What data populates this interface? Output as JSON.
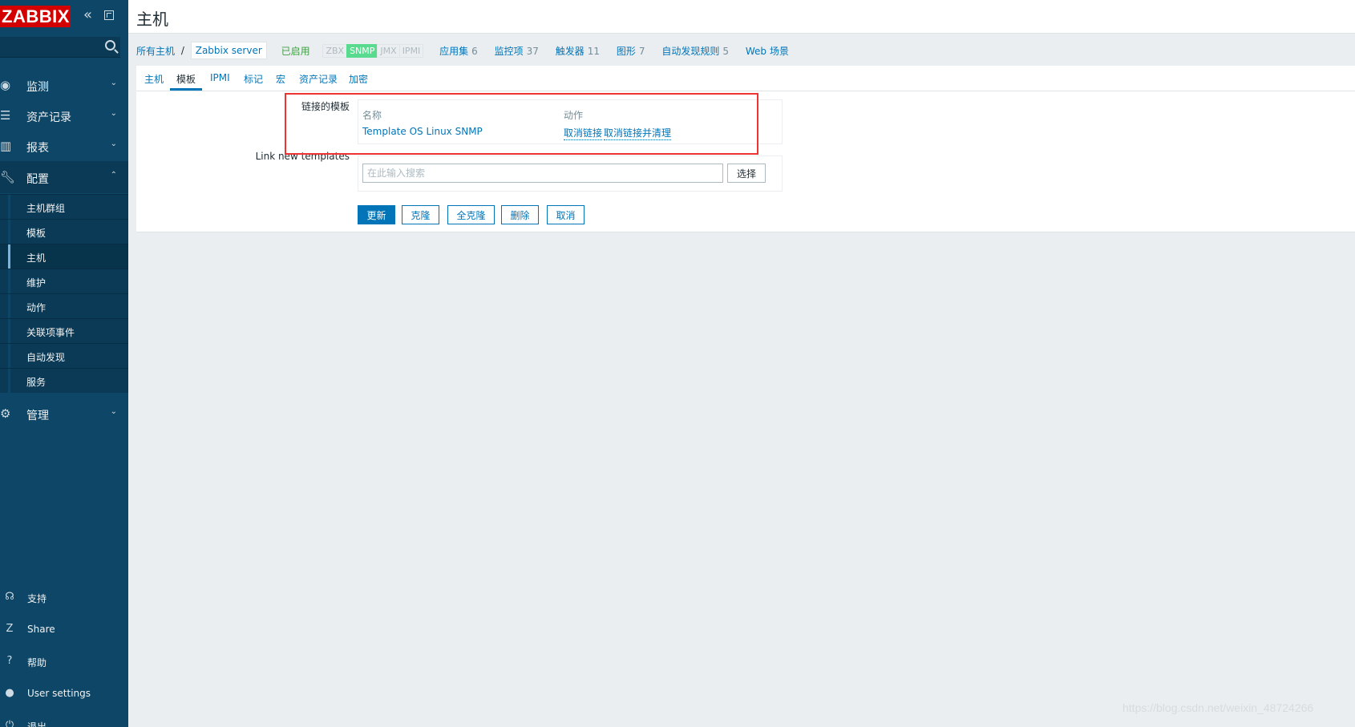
{
  "sidebar": {
    "logo": "ZABBIX",
    "collapse_icon": "«",
    "search_placeholder": "",
    "menu": [
      {
        "label": "监测",
        "icon": "eye-icon"
      },
      {
        "label": "资产记录",
        "icon": "list-icon"
      },
      {
        "label": "报表",
        "icon": "bar-chart-icon"
      },
      {
        "label": "配置",
        "icon": "wrench-icon"
      },
      {
        "label": "管理",
        "icon": "gear-icon"
      }
    ],
    "config_submenu": [
      "主机群组",
      "模板",
      "主机",
      "维护",
      "动作",
      "关联项事件",
      "自动发现",
      "服务"
    ],
    "bottom": [
      {
        "label": "支持",
        "icon": "headset-icon"
      },
      {
        "label": "Share",
        "icon": "share-icon"
      },
      {
        "label": "帮助",
        "icon": "help-icon"
      },
      {
        "label": "User settings",
        "icon": "user-icon"
      },
      {
        "label": "退出",
        "icon": "logout-icon"
      }
    ]
  },
  "header": {
    "title": "主机"
  },
  "host_nav": {
    "all_hosts": "所有主机",
    "separator": "/",
    "current_host": "Zabbix server",
    "status": "已启用",
    "availability": [
      "ZBX",
      "SNMP",
      "JMX",
      "IPMI"
    ],
    "links": [
      {
        "label": "应用集",
        "count": "6"
      },
      {
        "label": "监控项",
        "count": "37"
      },
      {
        "label": "触发器",
        "count": "11"
      },
      {
        "label": "图形",
        "count": "7"
      },
      {
        "label": "自动发现规则",
        "count": "5"
      },
      {
        "label": "Web 场景",
        "count": ""
      }
    ]
  },
  "tabs": [
    "主机",
    "模板",
    "IPMI",
    "标记",
    "宏",
    "资产记录",
    "加密"
  ],
  "form": {
    "linked_templates_label": "链接的模板",
    "col_name": "名称",
    "col_action": "动作",
    "template_name": "Template OS Linux SNMP",
    "unlink": "取消链接",
    "unlink_clear": "取消链接并清理",
    "link_new_label": "Link new templates",
    "search_placeholder": "在此输入搜索",
    "select_button": "选择",
    "buttons": {
      "update": "更新",
      "clone": "克隆",
      "full_clone": "全克隆",
      "delete": "删除",
      "cancel": "取消"
    }
  },
  "watermark": "https://blog.csdn.net/weixin_48724266",
  "colors": {
    "sidebar": "#0d4666",
    "accent": "#0275b8",
    "logo": "#d40000",
    "snmp_available": "#59db8f",
    "highlight": "#ee3333"
  }
}
